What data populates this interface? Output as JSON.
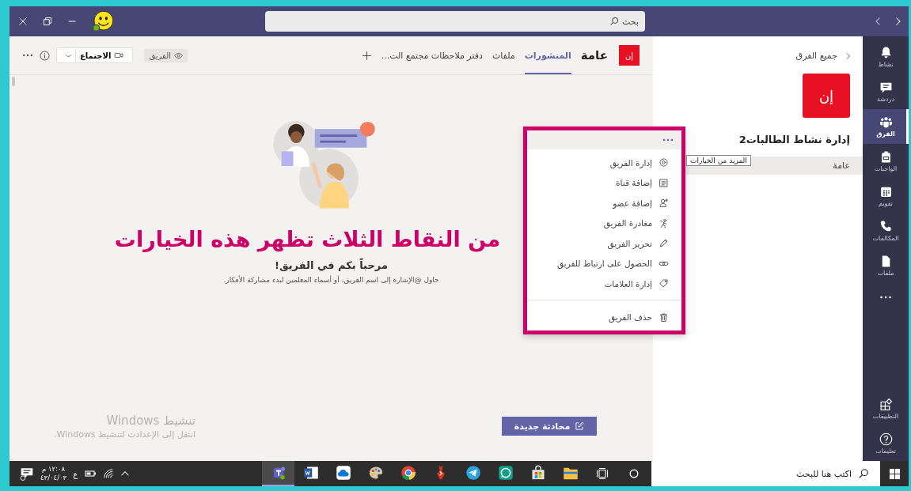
{
  "title_bar": {
    "search": {
      "placeholder": "بحث"
    }
  },
  "channel_header": {
    "team_initials": "إن",
    "channel_name": "عامة",
    "tabs": [
      {
        "label": "المنشورات",
        "selected": true
      },
      {
        "label": "ملفات",
        "selected": false
      },
      {
        "label": "دفتر ملاحظات مجتمع الت...",
        "selected": false
      }
    ],
    "team_badge": "الفريق",
    "meeting_button": "الاجتماع"
  },
  "welcome": {
    "annotation": "من النقاط الثلاث تظهر هذه الخيارات",
    "title": "مرحباً بكم في الفريق!",
    "hint": "حاول @الإشارة إلى اسم الفريق، أو أسماء المعلمين لبدء مشاركة الأفكار."
  },
  "windows_activation": {
    "title": "تنشيط Windows",
    "message": "انتقل إلى الإعدادت لتنشيط Windows."
  },
  "new_conversation_button": "محادثة جديدة",
  "team_menu": {
    "groups": [
      [
        {
          "kind": "gear",
          "label": "إدارة الفريق"
        },
        {
          "kind": "list",
          "label": "إضافة قناة"
        },
        {
          "kind": "person-add",
          "label": "إضافة عضو"
        },
        {
          "kind": "leave",
          "label": "مغادرة الفريق"
        },
        {
          "kind": "pencil",
          "label": "تحرير الفريق"
        },
        {
          "kind": "link",
          "label": "الحصول على ارتباط للفريق"
        },
        {
          "kind": "tag",
          "label": "إدارة العلامات"
        }
      ],
      [
        {
          "kind": "trash",
          "label": "حذف الفريق"
        }
      ]
    ]
  },
  "tooltip": "المزيد من الخيارات",
  "teams_panel": {
    "back_link": "جميع الفرق",
    "team_initials": "إن",
    "team_name": "إدارة نشاط الطالبات2",
    "channels": [
      {
        "label": "عامة",
        "selected": true
      }
    ]
  },
  "app_bar": {
    "items": [
      {
        "kind": "bell",
        "label": "نشاط",
        "selected": false
      },
      {
        "kind": "chat",
        "label": "دردشة",
        "selected": false
      },
      {
        "kind": "teams",
        "label": "الفرق",
        "selected": true
      },
      {
        "kind": "backpack",
        "label": "الواجبات",
        "selected": false
      },
      {
        "kind": "calendar",
        "label": "تقويم",
        "selected": false
      },
      {
        "kind": "phone",
        "label": "المكالمات",
        "selected": false
      },
      {
        "kind": "file",
        "label": "ملفات",
        "selected": false
      }
    ],
    "bottom_items": [
      {
        "kind": "apps",
        "label": "التطبيقات",
        "selected": false
      },
      {
        "kind": "help",
        "label": "تعليمات",
        "selected": false
      }
    ]
  },
  "taskbar": {
    "search": {
      "placeholder": "اكتب هنا للبحث"
    },
    "apps": [
      {
        "kind": "teams",
        "active": true
      },
      {
        "kind": "word",
        "active": false
      },
      {
        "kind": "cloud",
        "active": false
      },
      {
        "kind": "palette",
        "active": false
      },
      {
        "kind": "browser",
        "active": false
      },
      {
        "kind": "red",
        "active": false
      },
      {
        "kind": "telegram",
        "active": false
      },
      {
        "kind": "whatsapp",
        "active": false
      },
      {
        "kind": "store",
        "active": false
      },
      {
        "kind": "folder",
        "active": false
      }
    ],
    "language": "ع",
    "time": "١٢:٠٨ م",
    "date": "٤٣/٠٤/٠٣"
  }
}
